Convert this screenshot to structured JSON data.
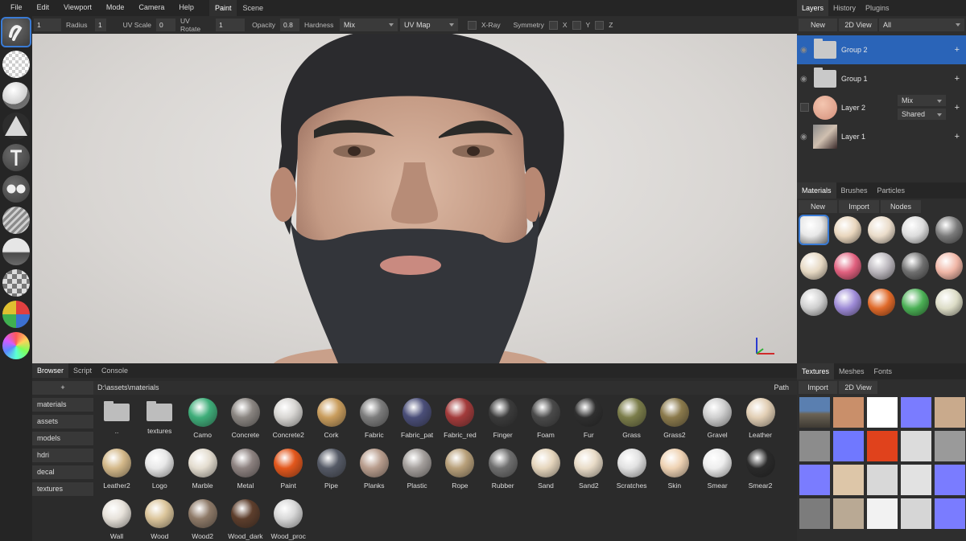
{
  "menu": [
    "File",
    "Edit",
    "Viewport",
    "Mode",
    "Camera",
    "Help"
  ],
  "top_tabs": [
    {
      "label": "Paint",
      "active": true
    },
    {
      "label": "Scene",
      "active": false
    }
  ],
  "toolbar": {
    "radius_value": "1",
    "radius_label": "Radius",
    "uvscale_value": "1",
    "uvscale_label": "UV Scale",
    "uvrotate_value": "0",
    "uvrotate_label": "UV Rotate",
    "opacity_value": "1",
    "opacity_label": "Opacity",
    "hardness_value": "0.8",
    "hardness_label": "Hardness",
    "blend_value": "Mix",
    "mapping_value": "UV Map",
    "xray_label": "X-Ray",
    "symmetry_label": "Symmetry",
    "x_label": "X",
    "y_label": "Y",
    "z_label": "Z"
  },
  "tools": [
    "brush-tool",
    "eraser-tool",
    "fill-tool",
    "decal-tool",
    "text-tool",
    "clone-tool",
    "blur-tool",
    "smudge-tool",
    "particle-tool",
    "colorid-tool",
    "picker-tool"
  ],
  "layers_panel": {
    "tabs": [
      {
        "label": "Layers",
        "active": true
      },
      {
        "label": "History",
        "active": false
      },
      {
        "label": "Plugins",
        "active": false
      }
    ],
    "new_label": "New",
    "view_label": "2D View",
    "filter_value": "All",
    "layers": [
      {
        "name": "Group 2",
        "selected": true,
        "kind": "folder"
      },
      {
        "name": "Group 1",
        "selected": false,
        "kind": "folder"
      },
      {
        "name": "Layer 2",
        "selected": false,
        "kind": "layer",
        "blend": "Mix",
        "mask": "Shared"
      },
      {
        "name": "Layer 1",
        "selected": false,
        "kind": "layer"
      }
    ]
  },
  "materials_panel": {
    "tabs": [
      {
        "label": "Materials",
        "active": true
      },
      {
        "label": "Brushes",
        "active": false
      },
      {
        "label": "Particles",
        "active": false
      }
    ],
    "new_label": "New",
    "import_label": "Import",
    "nodes_label": "Nodes",
    "swatch_colors": [
      "#e8e8e8",
      "#e9d6bd",
      "#eadcca",
      "#dcdcdc",
      "#7a7a7a",
      "#e6d8c2",
      "#e0607e",
      "#b9b5bb",
      "#6f6f6f",
      "#f0b6a6",
      "#cfcfcf",
      "#9d8ad6",
      "#e06a2a",
      "#4bb055",
      "#dcdcc6"
    ]
  },
  "textures_panel": {
    "tabs": [
      {
        "label": "Textures",
        "active": true
      },
      {
        "label": "Meshes",
        "active": false
      },
      {
        "label": "Fonts",
        "active": false
      }
    ],
    "import_label": "Import",
    "view_label": "2D View"
  },
  "browser": {
    "tabs": [
      {
        "label": "Browser",
        "active": true
      },
      {
        "label": "Script",
        "active": false
      },
      {
        "label": "Console",
        "active": false
      }
    ],
    "add_label": "+",
    "folders": [
      "materials",
      "assets",
      "models",
      "hdri",
      "decal",
      "textures"
    ],
    "path": "D:\\assets\\materials",
    "path_label": "Path",
    "assets": [
      {
        "name": "..",
        "kind": "folder",
        "color": "#bdbdbd"
      },
      {
        "name": "textures",
        "kind": "folder",
        "color": "#bdbdbd"
      },
      {
        "name": "Camo",
        "kind": "ball",
        "color": "#3fae7a"
      },
      {
        "name": "Concrete",
        "kind": "ball",
        "color": "#8a8581"
      },
      {
        "name": "Concrete2",
        "kind": "ball",
        "color": "#d8d6d3"
      },
      {
        "name": "Cork",
        "kind": "ball",
        "color": "#c99d5d"
      },
      {
        "name": "Fabric",
        "kind": "ball",
        "color": "#7c7c7c"
      },
      {
        "name": "Fabric_pat",
        "kind": "ball",
        "color": "#4a4e78"
      },
      {
        "name": "Fabric_red",
        "kind": "ball",
        "color": "#a33b3b"
      },
      {
        "name": "Finger",
        "kind": "ball",
        "color": "#3b3b3b"
      },
      {
        "name": "Foam",
        "kind": "ball",
        "color": "#4a4a4a"
      },
      {
        "name": "Fur",
        "kind": "ball",
        "color": "#2f2f2f"
      },
      {
        "name": "Grass",
        "kind": "ball",
        "color": "#7b7d4a"
      },
      {
        "name": "Grass2",
        "kind": "ball",
        "color": "#8b7a4c"
      },
      {
        "name": "Gravel",
        "kind": "ball",
        "color": "#cfcfcf"
      },
      {
        "name": "Leather",
        "kind": "ball",
        "color": "#e2cfb5"
      },
      {
        "name": "Leather2",
        "kind": "ball",
        "color": "#d4b98a"
      },
      {
        "name": "Logo",
        "kind": "ball",
        "color": "#e8e8e8"
      },
      {
        "name": "Marble",
        "kind": "ball",
        "color": "#e4ddd0"
      },
      {
        "name": "Metal",
        "kind": "ball",
        "color": "#8d8280"
      },
      {
        "name": "Paint",
        "kind": "ball",
        "color": "#e3571c"
      },
      {
        "name": "Pipe",
        "kind": "ball",
        "color": "#555a66"
      },
      {
        "name": "Planks",
        "kind": "ball",
        "color": "#b89d8d"
      },
      {
        "name": "Plastic",
        "kind": "ball",
        "color": "#a49f9c"
      },
      {
        "name": "Rope",
        "kind": "ball",
        "color": "#b8a07a"
      },
      {
        "name": "Rubber",
        "kind": "ball",
        "color": "#6f6f6f"
      },
      {
        "name": "Sand",
        "kind": "ball",
        "color": "#e6d6bd"
      },
      {
        "name": "Sand2",
        "kind": "ball",
        "color": "#e9dcc8"
      },
      {
        "name": "Scratches",
        "kind": "ball",
        "color": "#e2e2e2"
      },
      {
        "name": "Skin",
        "kind": "ball",
        "color": "#efd3b4"
      },
      {
        "name": "Smear",
        "kind": "ball",
        "color": "#eeeeee"
      },
      {
        "name": "Smear2",
        "kind": "ball",
        "color": "#2a2a2a"
      },
      {
        "name": "Wall",
        "kind": "ball",
        "color": "#e7e2da"
      },
      {
        "name": "Wood",
        "kind": "ball",
        "color": "#dcc69c"
      },
      {
        "name": "Wood2",
        "kind": "ball",
        "color": "#8e7a68"
      },
      {
        "name": "Wood_dark",
        "kind": "ball",
        "color": "#5d3e2c"
      },
      {
        "name": "Wood_proc",
        "kind": "ball",
        "color": "#d8d8d8"
      }
    ]
  },
  "colors": {
    "accent": "#2a64b8",
    "panel": "#2e2e2e",
    "menubar": "#252525"
  }
}
